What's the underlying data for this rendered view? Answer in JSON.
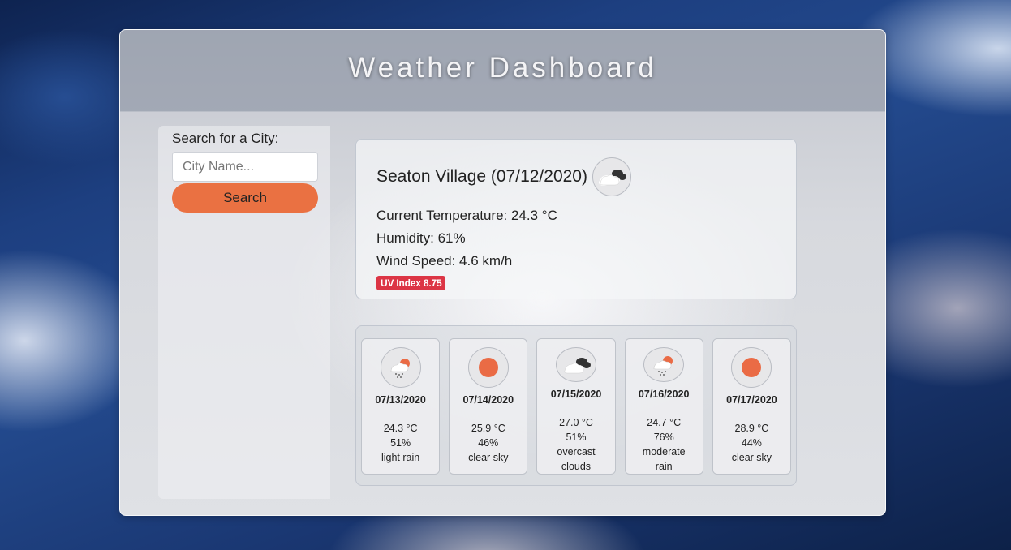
{
  "header": {
    "title": "Weather Dashboard"
  },
  "search": {
    "label": "Search for a City:",
    "placeholder": "City Name...",
    "button_label": "Search"
  },
  "current": {
    "city_date": "Seaton Village (07/12/2020)",
    "icon": "overcast-clouds-icon",
    "temperature": "Current Temperature: 24.3 °C",
    "humidity": "Humidity: 61%",
    "wind": "Wind Speed: 4.6 km/h",
    "uv": "UV Index 8.75",
    "uv_color": "#dc3545"
  },
  "forecast": [
    {
      "date": "07/13/2020",
      "temp": "24.3 °C",
      "humidity": "51%",
      "desc": "light rain",
      "icon": "light-rain-icon"
    },
    {
      "date": "07/14/2020",
      "temp": "25.9 °C",
      "humidity": "46%",
      "desc": "clear sky",
      "icon": "clear-sky-icon"
    },
    {
      "date": "07/15/2020",
      "temp": "27.0 °C",
      "humidity": "51%",
      "desc": "overcast clouds",
      "icon": "overcast-clouds-icon"
    },
    {
      "date": "07/16/2020",
      "temp": "24.7 °C",
      "humidity": "76%",
      "desc": "moderate rain",
      "icon": "moderate-rain-icon"
    },
    {
      "date": "07/17/2020",
      "temp": "28.9 °C",
      "humidity": "44%",
      "desc": "clear sky",
      "icon": "clear-sky-icon"
    }
  ],
  "colors": {
    "accent": "#ea7142",
    "sun": "#ea6b45",
    "uv": "#dc3545"
  }
}
